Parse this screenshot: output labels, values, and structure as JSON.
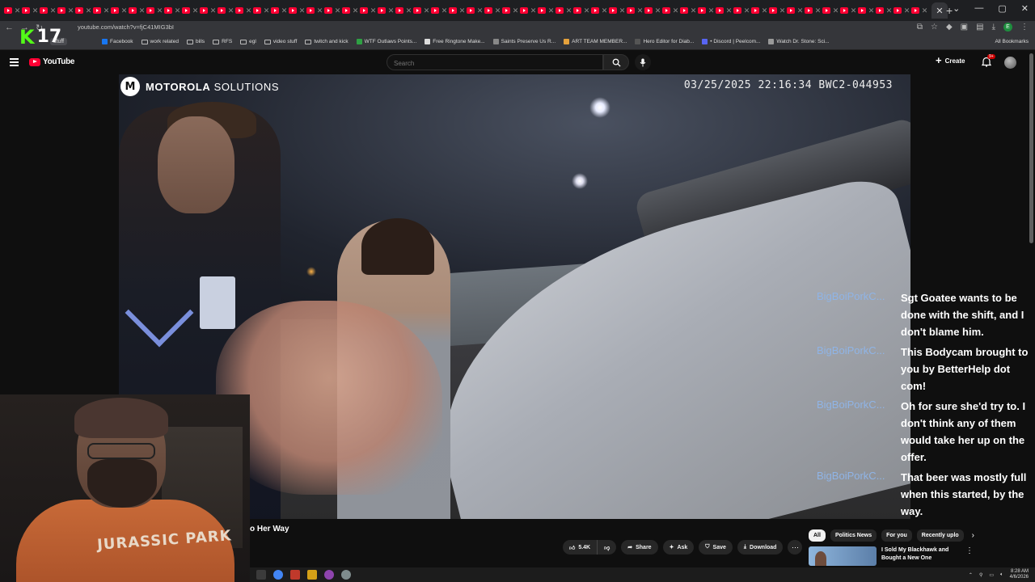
{
  "browser": {
    "url": "youtube.com/watch?v=fjC41MIG3bI",
    "bookmarks_pinned": "stuff",
    "bookmarks": [
      {
        "label": "Facebook",
        "icon": "facebook-icon",
        "color": "#1877f2"
      },
      {
        "label": "work related",
        "icon": "folder-icon"
      },
      {
        "label": "bills",
        "icon": "folder-icon"
      },
      {
        "label": "RFS",
        "icon": "folder-icon"
      },
      {
        "label": "egl",
        "icon": "folder-icon"
      },
      {
        "label": "video stuff",
        "icon": "folder-icon"
      },
      {
        "label": "twitch and kick",
        "icon": "folder-icon"
      },
      {
        "label": "WTF Outlaws Points...",
        "icon": "site-icon",
        "color": "#2ea043"
      },
      {
        "label": "Free Ringtone Make...",
        "icon": "site-icon",
        "color": "#ddd"
      },
      {
        "label": "Saints Preserve Us R...",
        "icon": "site-icon",
        "color": "#888"
      },
      {
        "label": "ART TEAM MEMBER...",
        "icon": "site-icon",
        "color": "#e6a23c"
      },
      {
        "label": "Hero Editor for Diab...",
        "icon": "site-icon",
        "color": "#555"
      },
      {
        "label": "• Discord | Peelcom...",
        "icon": "discord-icon",
        "color": "#5865f2"
      },
      {
        "label": "Watch Dr. Stone: Sci...",
        "icon": "site-icon",
        "color": "#999"
      }
    ],
    "all_bookmarks": "All Bookmarks",
    "profile_initial": "E"
  },
  "overlay": {
    "kick_logo": "K",
    "viewer_count": "17"
  },
  "youtube": {
    "logo_text": "YouTube",
    "search_placeholder": "Search",
    "create_label": "Create",
    "notifications_badge": "9+"
  },
  "video": {
    "brand_strong": "MOTOROLA",
    "brand_light": " SOLUTIONS",
    "timestamp": "03/25/2025 22:16:34 BWC2-044953",
    "title_visible": "o Her Way"
  },
  "chat": [
    {
      "user": "BigBoiPorkC...",
      "text": "Sgt Goatee wants to be done with the shift, and I don't blame him."
    },
    {
      "user": "BigBoiPorkC...",
      "text": "This Bodycam brought to you by BetterHelp dot com!"
    },
    {
      "user": "BigBoiPorkC...",
      "text": "Oh for sure she'd try to. I don't think any of them would take her up on the offer."
    },
    {
      "user": "BigBoiPorkC...",
      "text": "That beer was mostly full when this started, by the way."
    }
  ],
  "actions": {
    "likes": "5.4K",
    "share": "Share",
    "ask": "Ask",
    "save": "Save",
    "download": "Download"
  },
  "chips": [
    "All",
    "Politics News",
    "For you",
    "Recently uplo"
  ],
  "recommendation": {
    "title": "I Sold My Blackhawk and Bought a New One"
  },
  "webcam": {
    "shirt_text": "JURASSIC PARK"
  },
  "taskbar": {
    "time": "8:28 AM",
    "date": "4/6/2026"
  }
}
